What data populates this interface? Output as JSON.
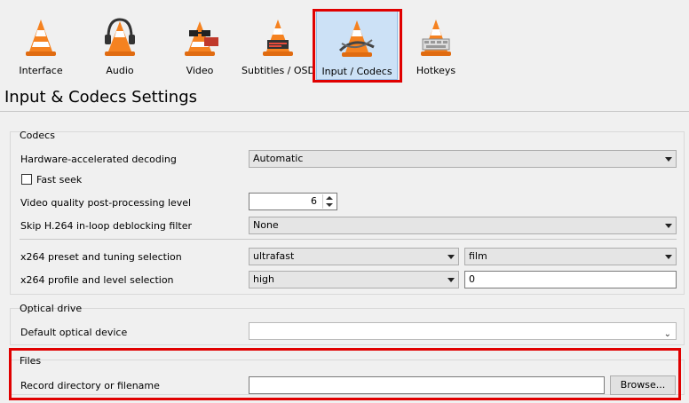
{
  "tabs": [
    {
      "label": "Interface",
      "icon": "cone-interface-icon"
    },
    {
      "label": "Audio",
      "icon": "cone-headphones-icon"
    },
    {
      "label": "Video",
      "icon": "cone-glasses-icon"
    },
    {
      "label": "Subtitles / OSD",
      "icon": "cone-subtitles-icon"
    },
    {
      "label": "Input / Codecs",
      "icon": "cone-codecs-icon"
    },
    {
      "label": "Hotkeys",
      "icon": "cone-hotkeys-icon"
    }
  ],
  "page_title": "Input & Codecs Settings",
  "codecs": {
    "title": "Codecs",
    "hw_label": "Hardware-accelerated decoding",
    "hw_value": "Automatic",
    "fast_seek_label": "Fast seek",
    "pp_label": "Video quality post-processing level",
    "pp_value": "6",
    "skip_label": "Skip H.264 in-loop deblocking filter",
    "skip_value": "None",
    "x264_preset_label": "x264 preset and tuning selection",
    "x264_preset_value": "ultrafast",
    "x264_tune_value": "film",
    "x264_profile_label": "x264 profile and level selection",
    "x264_profile_value": "high",
    "x264_level_value": "0"
  },
  "optical": {
    "title": "Optical drive",
    "device_label": "Default optical device",
    "device_value": ""
  },
  "files": {
    "title": "Files",
    "record_label": "Record directory or filename",
    "record_value": "",
    "browse_label": "Browse..."
  },
  "colors": {
    "highlight": "#e00000",
    "active_tab": "#cce1f6",
    "cone_orange": "#f58220"
  }
}
